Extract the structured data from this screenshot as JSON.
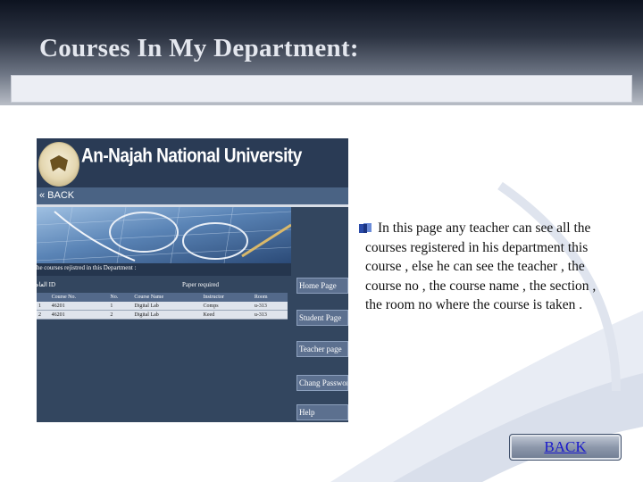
{
  "slide": {
    "title": "Courses In My Department:",
    "description": "In this page any teacher can see all the courses registered in his department this course , else he can see the teacher , the course no , the course name , the section , the room no where the course is taken .",
    "back_button_label": "BACK"
  },
  "screenshot": {
    "university_name": "An-Najah National University",
    "back_link": "« BACK",
    "courses_caption": "the courses rejistred in this Department :",
    "meta_left": "العام    ID",
    "meta_right": "Paper required",
    "table": {
      "headers": [
        "",
        "Course No.",
        "No.",
        "Course Name",
        "Instructor",
        "Room"
      ],
      "rows": [
        [
          "1",
          "46201",
          "1",
          "Digital Lab",
          "Comps",
          "u-313"
        ],
        [
          "2",
          "46201",
          "2",
          "Digital Lab",
          "Keed",
          "u-313"
        ]
      ]
    },
    "side_buttons": [
      "Home Page",
      "Student Page",
      "Teacher page",
      "Chang Password",
      "Help"
    ]
  },
  "colors": {
    "title_text": "#e4e7ee",
    "screenshot_bg": "#33465f",
    "side_button": "#5c708f",
    "back_button_link": "#1a1acc"
  }
}
